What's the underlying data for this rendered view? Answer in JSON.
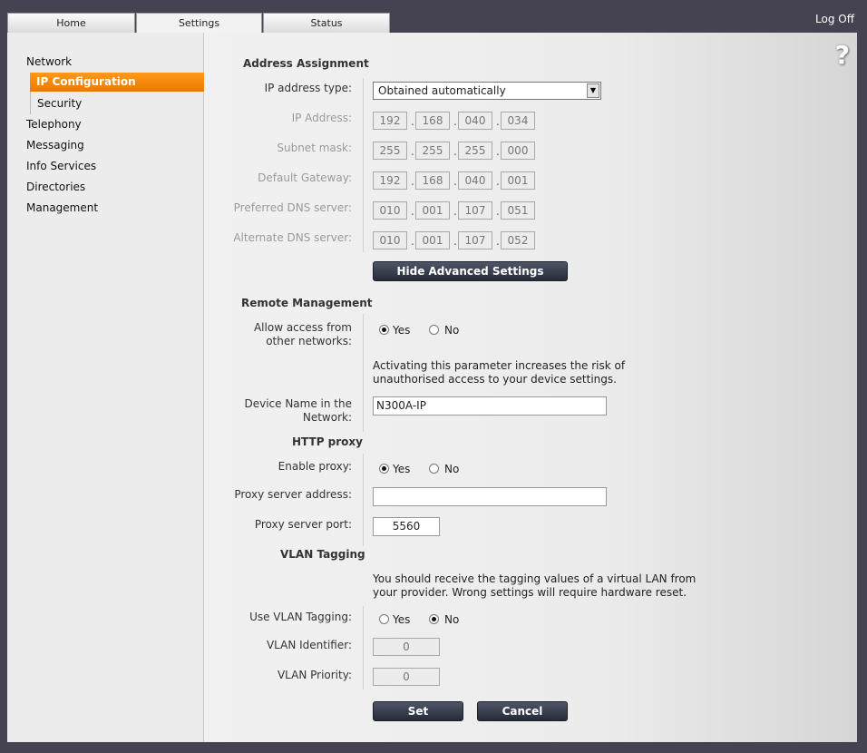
{
  "tabs": [
    {
      "label": "Home"
    },
    {
      "label": "Settings"
    },
    {
      "label": "Status"
    }
  ],
  "logoff": "Log Off",
  "help": "?",
  "sidebar": {
    "items": [
      {
        "label": "Network"
      },
      {
        "label": "IP Configuration"
      },
      {
        "label": "Security"
      },
      {
        "label": "Telephony"
      },
      {
        "label": "Messaging"
      },
      {
        "label": "Info Services"
      },
      {
        "label": "Directories"
      },
      {
        "label": "Management"
      }
    ]
  },
  "address": {
    "title": "Address Assignment",
    "ip_type_label": "IP address type:",
    "ip_type_value": "Obtained automatically",
    "rows": [
      {
        "label": "IP Address:",
        "octets": [
          "192",
          "168",
          "040",
          "034"
        ]
      },
      {
        "label": "Subnet mask:",
        "octets": [
          "255",
          "255",
          "255",
          "000"
        ]
      },
      {
        "label": "Default Gateway:",
        "octets": [
          "192",
          "168",
          "040",
          "001"
        ]
      },
      {
        "label": "Preferred DNS server:",
        "octets": [
          "010",
          "001",
          "107",
          "051"
        ]
      },
      {
        "label": "Alternate DNS server:",
        "octets": [
          "010",
          "001",
          "107",
          "052"
        ]
      }
    ],
    "advanced_button": "Hide Advanced Settings"
  },
  "remote": {
    "title": "Remote Management",
    "allow_label": "Allow access from other networks:",
    "yes": "Yes",
    "no": "No",
    "note": "Activating this parameter increases the risk of unauthorised access to your device settings.",
    "device_name_label": "Device Name in the Network:",
    "device_name_value": "N300A-IP"
  },
  "proxy": {
    "title": "HTTP proxy",
    "enable_label": "Enable proxy:",
    "yes": "Yes",
    "no": "No",
    "address_label": "Proxy server address:",
    "address_value": "",
    "port_label": "Proxy server port:",
    "port_value": "5560"
  },
  "vlan": {
    "title": "VLAN Tagging",
    "note": "You should receive the tagging values of a virtual LAN from your provider. Wrong settings will require hardware reset.",
    "use_label": "Use VLAN Tagging:",
    "yes": "Yes",
    "no": "No",
    "id_label": "VLAN Identifier:",
    "id_value": "0",
    "priority_label": "VLAN Priority:",
    "priority_value": "0"
  },
  "actions": {
    "set": "Set",
    "cancel": "Cancel"
  }
}
